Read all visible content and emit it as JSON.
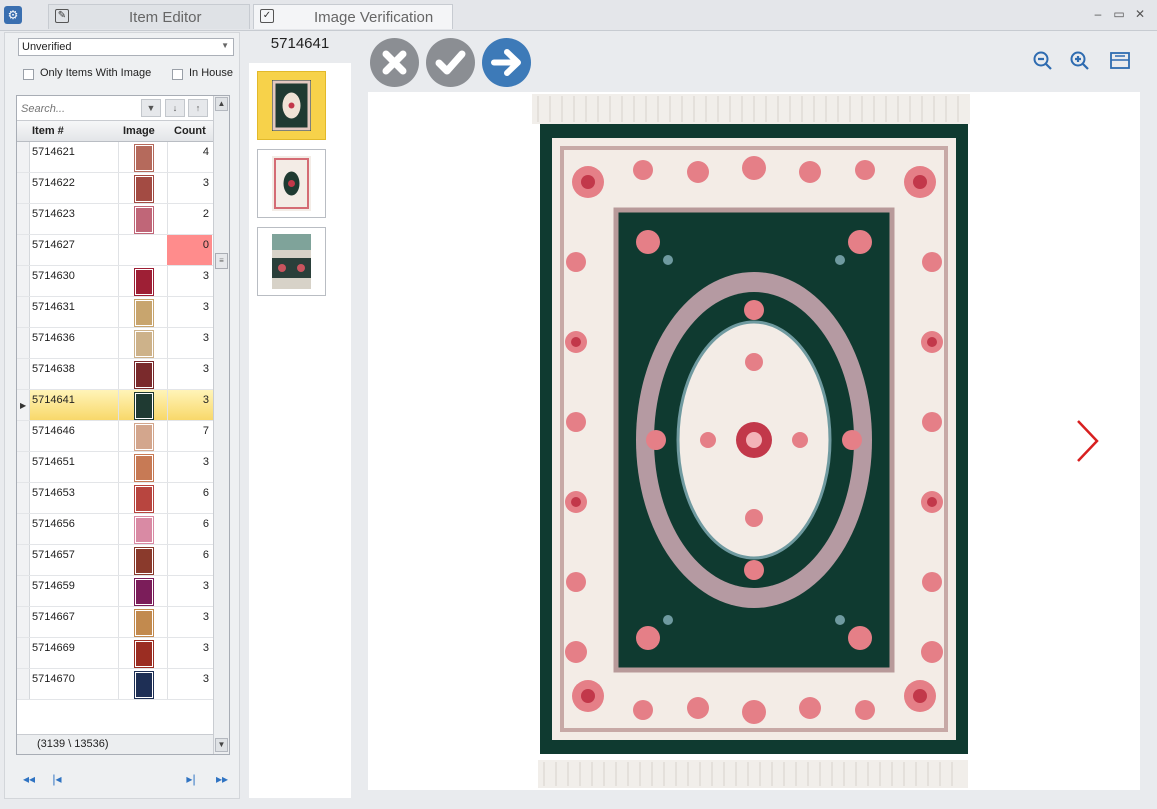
{
  "tabs": [
    {
      "label": "Item Editor"
    },
    {
      "label": "Image Verification"
    }
  ],
  "window_controls": {
    "minimize": "–",
    "maximize": "▭",
    "close": "✕"
  },
  "filters": {
    "status_value": "Unverified",
    "only_items_with_image_label": "Only Items With Image",
    "in_house_label": "In House"
  },
  "search": {
    "placeholder": "Search..."
  },
  "grid": {
    "columns": [
      "Item #",
      "Image",
      "Count"
    ],
    "rows": [
      {
        "item": "5714621",
        "count": "4",
        "thumb_color": "#b56a5c"
      },
      {
        "item": "5714622",
        "count": "3",
        "thumb_color": "#a34b43"
      },
      {
        "item": "5714623",
        "count": "2",
        "thumb_color": "#c06678"
      },
      {
        "item": "5714627",
        "count": "0",
        "thumb_color": ""
      },
      {
        "item": "5714630",
        "count": "3",
        "thumb_color": "#9e1f35"
      },
      {
        "item": "5714631",
        "count": "3",
        "thumb_color": "#c8a56e"
      },
      {
        "item": "5714636",
        "count": "3",
        "thumb_color": "#cdb28a"
      },
      {
        "item": "5714638",
        "count": "3",
        "thumb_color": "#7a2a2c"
      },
      {
        "item": "5714641",
        "count": "3",
        "thumb_color": "#1f3a32"
      },
      {
        "item": "5714646",
        "count": "7",
        "thumb_color": "#d3a68d"
      },
      {
        "item": "5714651",
        "count": "3",
        "thumb_color": "#c77a55"
      },
      {
        "item": "5714653",
        "count": "6",
        "thumb_color": "#b8453f"
      },
      {
        "item": "5714656",
        "count": "6",
        "thumb_color": "#d98aa4"
      },
      {
        "item": "5714657",
        "count": "6",
        "thumb_color": "#8a3a2c"
      },
      {
        "item": "5714659",
        "count": "3",
        "thumb_color": "#7b1d5a"
      },
      {
        "item": "5714667",
        "count": "3",
        "thumb_color": "#c28a4e"
      },
      {
        "item": "5714669",
        "count": "3",
        "thumb_color": "#9b2d22"
      },
      {
        "item": "5714670",
        "count": "3",
        "thumb_color": "#1e2f55"
      }
    ],
    "footer": "(3139 \\ 13536)"
  },
  "current_item": "5714641",
  "colors": {
    "accent_blue": "#3d7ab8",
    "selected_row": "#f8d86a",
    "zero_count": "#ff8c8c",
    "rug_green": "#0f3a30",
    "next_arrow": "#d82020"
  },
  "icons": {
    "reject": "x-icon",
    "approve": "check-icon",
    "next": "arrow-right-icon",
    "zoom_out": "zoom-out-icon",
    "zoom_in": "zoom-in-icon",
    "fit": "fit-page-icon"
  }
}
